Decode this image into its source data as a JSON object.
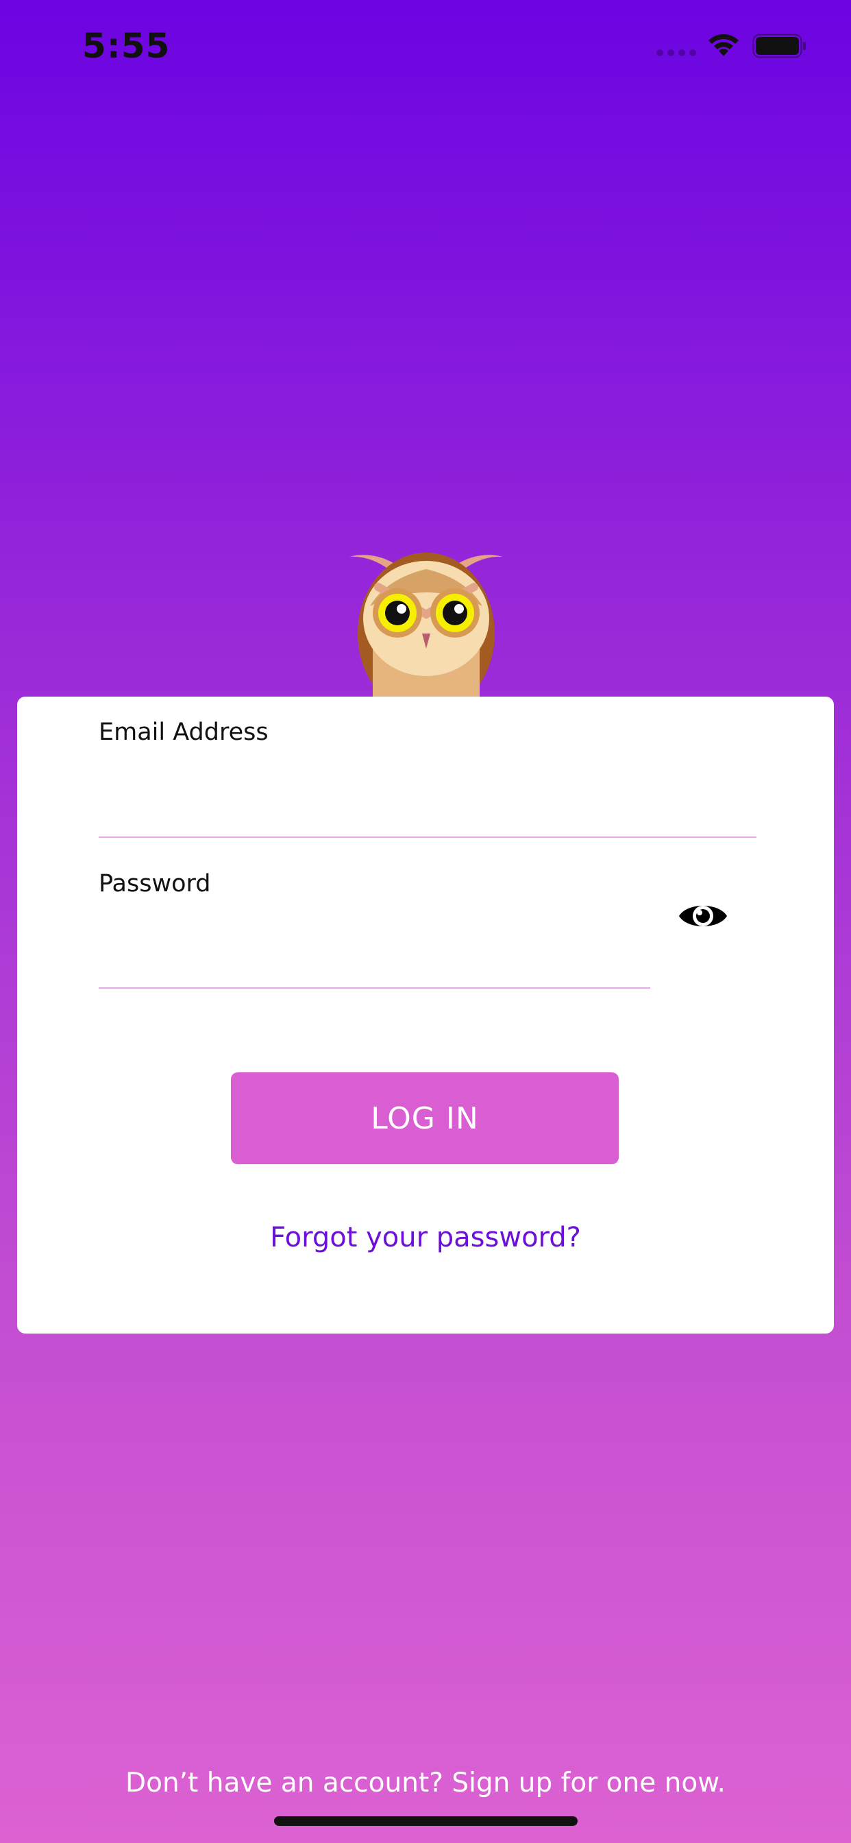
{
  "status_bar": {
    "time": "5:55",
    "icons": [
      "cellular-signal-icon",
      "wifi-icon",
      "battery-icon"
    ]
  },
  "logo": {
    "icon": "owl-icon"
  },
  "login_form": {
    "email_label": "Email Address",
    "email_value": "",
    "email_placeholder": "",
    "password_label": "Password",
    "password_value": "",
    "password_placeholder": "",
    "show_password_icon": "eye-icon",
    "login_button_label": "LOG IN",
    "forgot_password_link": "Forgot your password?"
  },
  "footer": {
    "signup_prompt": "Don’t have an account? Sign up for one now."
  },
  "colors": {
    "gradient_top": "#6c04e2",
    "gradient_bottom": "#dc62d2",
    "button": "#d95ed1",
    "link": "#6c10d8",
    "input_underline": "#e8a6e6"
  }
}
